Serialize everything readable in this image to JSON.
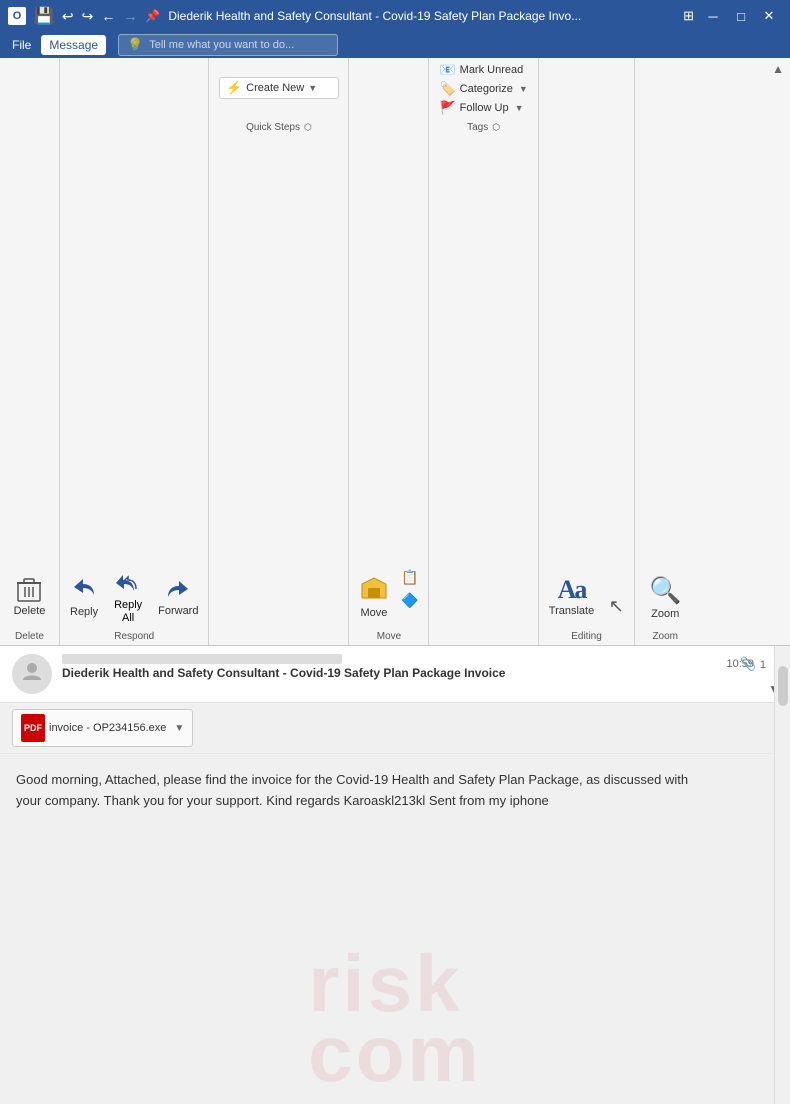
{
  "titlebar": {
    "title": "Diederik Health and Safety Consultant - Covid-19 Safety Plan Package Invo...",
    "controls": [
      "minimize",
      "maximize",
      "close"
    ],
    "save_icon": "💾",
    "undo_icon": "↩",
    "redo_icon": "↪",
    "back_icon": "←",
    "forward_icon": "→",
    "pin_icon": "📌"
  },
  "menubar": {
    "items": [
      "File",
      "Message"
    ],
    "active": "Message",
    "search_placeholder": "Tell me what you want to do...",
    "search_icon": "💡"
  },
  "ribbon": {
    "groups": [
      {
        "name": "Delete",
        "label": "Delete",
        "buttons": [
          {
            "id": "delete",
            "label": "Delete",
            "icon": "🗑️",
            "size": "large"
          }
        ]
      },
      {
        "name": "Respond",
        "label": "Respond",
        "buttons": [
          {
            "id": "reply",
            "label": "Reply",
            "icon": "reply",
            "size": "medium"
          },
          {
            "id": "reply-all",
            "label": "Reply\nAll",
            "icon": "reply-all",
            "size": "medium"
          },
          {
            "id": "forward",
            "label": "Forward",
            "icon": "forward",
            "size": "medium"
          }
        ]
      },
      {
        "name": "QuickSteps",
        "label": "Quick Steps",
        "buttons": [
          {
            "id": "create-new",
            "label": "Create New",
            "icon": "⚡"
          }
        ]
      },
      {
        "name": "Move",
        "label": "Move",
        "buttons": [
          {
            "id": "move",
            "label": "Move",
            "icon": "📁",
            "size": "large"
          },
          {
            "id": "rules",
            "label": "",
            "icon": "📋"
          },
          {
            "id": "onenote",
            "label": "",
            "icon": "🔷"
          }
        ]
      },
      {
        "name": "Tags",
        "label": "Tags",
        "buttons": [
          {
            "id": "mark-unread",
            "label": "Mark Unread",
            "icon": "📧"
          },
          {
            "id": "categorize",
            "label": "Categorize",
            "icon": "🏷️"
          },
          {
            "id": "follow-up",
            "label": "Follow Up",
            "icon": "🚩"
          }
        ]
      },
      {
        "name": "Editing",
        "label": "Editing",
        "buttons": [
          {
            "id": "translate",
            "label": "Translate",
            "icon": "🔤",
            "size": "large"
          },
          {
            "id": "cursor",
            "label": "",
            "icon": "↖"
          }
        ]
      },
      {
        "name": "Zoom",
        "label": "Zoom",
        "buttons": [
          {
            "id": "zoom",
            "label": "Zoom",
            "icon": "🔍",
            "size": "large"
          }
        ]
      }
    ]
  },
  "email": {
    "sender_display": "████████ ██████████████ ██████████ ██ ████",
    "subject": "Diederik Health and Safety Consultant - Covid-19 Safety Plan Package Invoice",
    "time": "10:59",
    "attachment_count": "1",
    "attachment": {
      "name": "invoice - OP234156.exe",
      "type": "PDF",
      "icon_text": "PDF"
    },
    "body": "Good morning, Attached, please find the invoice for the Covid-19 Health and Safety Plan Package, as discussed with your company. Thank you for your support. Kind regards Karoaskl213kl Sent from my iphone"
  },
  "watermark": {
    "text": "risk.com",
    "line1": "risk",
    "line2": "com"
  }
}
